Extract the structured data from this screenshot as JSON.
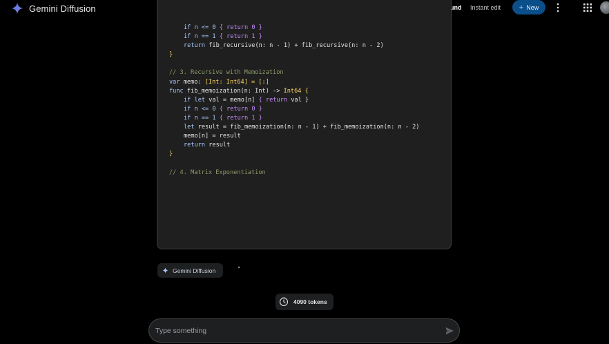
{
  "app": {
    "title": "Gemini Diffusion",
    "logo_icon": "gemini-sparkle-icon"
  },
  "nav": {
    "playground": "Playground",
    "instant_edit": "Instant edit",
    "new_label": "New"
  },
  "code": {
    "lines": [
      [
        [
          "if n <= 0 ",
          "#a8c7fa"
        ],
        [
          "{ return 0 }",
          "#c58af9"
        ]
      ],
      [
        [
          "if n == 1 ",
          "#a8c7fa"
        ],
        [
          "{ return 1 }",
          "#c58af9"
        ]
      ],
      [
        [
          "return ",
          "#a8c7fa"
        ],
        [
          "fib_recursive(n: n - 1) + fib_recursive(n: n - 2)",
          "#e3e3e3"
        ]
      ],
      [
        [
          "}",
          "#fdd663"
        ]
      ],
      [
        [
          "",
          "#e3e3e3"
        ]
      ],
      [
        [
          "// 3. Recursive with Memoization",
          "#8f9c6b"
        ]
      ],
      [
        [
          "var ",
          "#a8c7fa"
        ],
        [
          "memo: ",
          "#e3e3e3"
        ],
        [
          "[Int: Int64] = [:]",
          "#fdd663"
        ]
      ],
      [
        [
          "func ",
          "#a8c7fa"
        ],
        [
          "fib_memoization(n: Int) -> ",
          "#e3e3e3"
        ],
        [
          "Int64 {",
          "#fdd663"
        ]
      ],
      [
        [
          "if let ",
          "#a8c7fa"
        ],
        [
          "val = memo[n] ",
          "#e3e3e3"
        ],
        [
          "{ return ",
          "#c58af9"
        ],
        [
          "val }",
          "#e3e3e3"
        ]
      ],
      [
        [
          "if n <= 0 ",
          "#a8c7fa"
        ],
        [
          "{ return 0 }",
          "#c58af9"
        ]
      ],
      [
        [
          "if n == 1 ",
          "#a8c7fa"
        ],
        [
          "{ return 1 }",
          "#c58af9"
        ]
      ],
      [
        [
          "let ",
          "#a8c7fa"
        ],
        [
          "result = fib_memoization(n: n - 1) + fib_memoization(n: n - 2)",
          "#e3e3e3"
        ]
      ],
      [
        [
          "memo[n] = result",
          "#e3e3e3"
        ]
      ],
      [
        [
          "return ",
          "#a8c7fa"
        ],
        [
          "result",
          "#e3e3e3"
        ]
      ],
      [
        [
          "}",
          "#fdd663"
        ]
      ],
      [
        [
          "",
          "#e3e3e3"
        ]
      ],
      [
        [
          "// 4. Matrix Exponentiation",
          "#8f9c6b"
        ]
      ]
    ],
    "indents": [
      1,
      1,
      1,
      0,
      0,
      0,
      0,
      0,
      1,
      1,
      1,
      1,
      1,
      1,
      0,
      0,
      0
    ]
  },
  "model_chip": "Gemini Diffusion",
  "tokens_label": "4090 tokens",
  "input": {
    "placeholder": "Type something"
  },
  "colors": {
    "accent": "#0b4f8a",
    "panel": "#1f1f1f",
    "comment": "#8f9c6b",
    "keyword": "#a8c7fa",
    "brace": "#c58af9",
    "type": "#fdd663"
  }
}
